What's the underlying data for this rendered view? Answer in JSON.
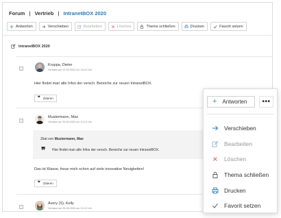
{
  "breadcrumb": {
    "items": [
      "Forum",
      "Vertrieb",
      "IntranetBOX 2020"
    ],
    "separator": "|"
  },
  "toolbar": {
    "buttons": [
      {
        "label": "Antworten",
        "icon": "plus-icon",
        "disabled": false
      },
      {
        "label": "Verschieben",
        "icon": "arrow-right-icon",
        "disabled": false
      },
      {
        "label": "Bearbeiten",
        "icon": "edit-icon",
        "disabled": true
      },
      {
        "label": "Löschen",
        "icon": "delete-icon",
        "disabled": true
      },
      {
        "label": "Thema schließen",
        "icon": "lock-icon",
        "disabled": false
      },
      {
        "label": "Drucken",
        "icon": "print-icon",
        "disabled": false
      },
      {
        "label": "Favorit setzen",
        "icon": "check-icon",
        "disabled": false
      }
    ]
  },
  "topic": {
    "title": "IntranetBOX 2020",
    "icon": "edit-icon"
  },
  "posts": [
    {
      "author": "Kruppa, Dieter",
      "date": "Verfasst am 22.06.2020 um 18:10 Uhr",
      "text": "Hier findet man alle Infos der versch. Bereiche zur neuen IntranetBOX.",
      "cite_label": "Zitieren"
    },
    {
      "author": "Mustermann, Max",
      "date": "Verfasst am 25.06.2020 um 10:13 Uhr",
      "quote_prefix": "Zitat von",
      "quote_author": "Mustermann, Max",
      "quote_text": "Hier findet man alle Infos der versch. Bereiche zur neuen IntranetBOX.",
      "text": "Das ist Klasse, freue mich schon auf viele innovative Neuigkeiten!",
      "cite_label": "Zitieren"
    },
    {
      "author": "Avery (S), Kelly",
      "date": "Verfasst am 25.06.2020 um 10:13 Uhr"
    }
  ],
  "popup": {
    "answer_label": "Antworten",
    "more_label": "•••",
    "menu": [
      {
        "label": "Verschieben",
        "icon": "arrow-right-icon",
        "disabled": false
      },
      {
        "label": "Bearbeiten",
        "icon": "edit-icon",
        "disabled": true
      },
      {
        "label": "Löschen",
        "icon": "delete-icon",
        "disabled": true
      },
      {
        "label": "Thema schließen",
        "icon": "lock-icon",
        "disabled": false
      },
      {
        "label": "Drucken",
        "icon": "print-icon",
        "disabled": false
      },
      {
        "label": "Favorit setzen",
        "icon": "check-icon",
        "disabled": false
      }
    ]
  },
  "colors": {
    "accent": "#2a7ab8",
    "green": "#3aa54a",
    "delete": "#e0675b"
  }
}
